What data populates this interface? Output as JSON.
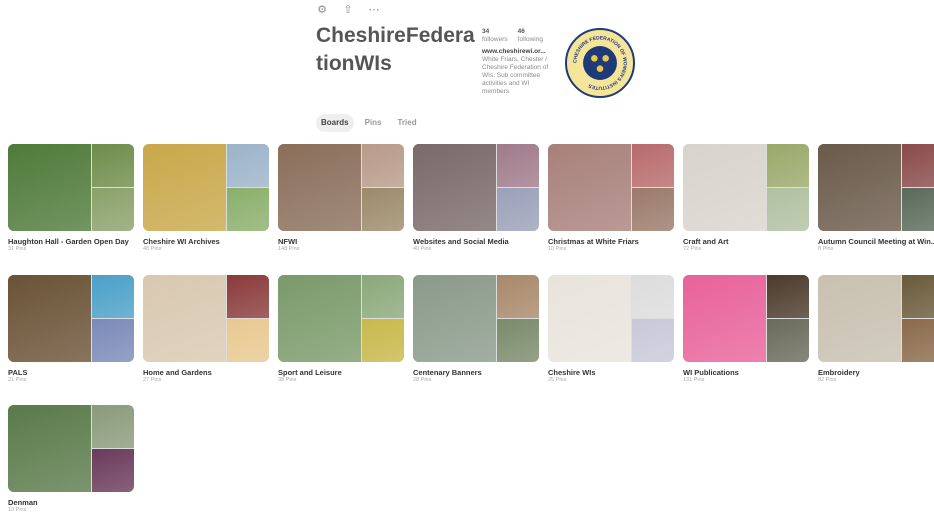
{
  "profile": {
    "name": "CheshireFederationWIs",
    "followers_count": "34",
    "followers_label": "followers",
    "following_count": "46",
    "following_label": "following",
    "website": "www.cheshirewi.or...",
    "bio": "White Friars, Chester / Cheshire Federation of WIs. Sub committee activities and WI members",
    "logo_text": "CHESHIRE FEDERATION OF WOMEN'S INSTITUTES"
  },
  "top_icons": [
    "gear-icon",
    "share-icon",
    "more-icon"
  ],
  "tabs": [
    {
      "label": "Boards",
      "active": true
    },
    {
      "label": "Pins",
      "active": false
    },
    {
      "label": "Tried",
      "active": false
    }
  ],
  "boards": [
    {
      "title": "Haughton Hall - Garden Open Day",
      "pins": "31 Pins",
      "colors": [
        "#4f7a3a",
        "#6e8c4a",
        "#8aa16a"
      ]
    },
    {
      "title": "Cheshire WI Archives",
      "pins": "48 Pins",
      "colors": [
        "#c9a84a",
        "#9bb3c8",
        "#8aaf6a"
      ]
    },
    {
      "title": "NFWI",
      "pins": "148 Pins",
      "colors": [
        "#8a6e5a",
        "#b89a88",
        "#9c8a6a"
      ]
    },
    {
      "title": "Websites and Social Media",
      "pins": "40 Pins",
      "colors": [
        "#7a6a6a",
        "#a07a8a",
        "#9aa0b8"
      ]
    },
    {
      "title": "Christmas at White Friars",
      "pins": "10 Pins",
      "colors": [
        "#a8807a",
        "#b86a6a",
        "#9a7a6a"
      ]
    },
    {
      "title": "Craft and Art",
      "pins": "72 Pins",
      "colors": [
        "#d8d4cc",
        "#9aa86a",
        "#b0c0a0"
      ]
    },
    {
      "title": "Autumn Council Meeting at Win...",
      "pins": "8 Pins",
      "colors": [
        "#6a5a4a",
        "#8a4a4a",
        "#5a6a5a"
      ]
    },
    {
      "title": "PALS",
      "pins": "21 Pins",
      "colors": [
        "#6a5236",
        "#4aa0c8",
        "#7a8ab8"
      ]
    },
    {
      "title": "Home and Gardens",
      "pins": "27 Pins",
      "colors": [
        "#d8c8b0",
        "#8a3a3a",
        "#e8c890"
      ]
    },
    {
      "title": "Sport and Leisure",
      "pins": "38 Pins",
      "colors": [
        "#7a9a6a",
        "#8aa87a",
        "#c8b84a"
      ]
    },
    {
      "title": "Centenary Banners",
      "pins": "28 Pins",
      "colors": [
        "#8a9a8a",
        "#a8886a",
        "#7a8a6a"
      ]
    },
    {
      "title": "Cheshire WIs",
      "pins": "25 Pins",
      "colors": [
        "#e8e4dc",
        "#dcdcdc",
        "#c8c8d8"
      ]
    },
    {
      "title": "WI Publications",
      "pins": "131 Pins",
      "colors": [
        "#e8629a",
        "#4a3a2a",
        "#6a6a5a"
      ]
    },
    {
      "title": "Embroidery",
      "pins": "82 Pins",
      "colors": [
        "#c8c0b0",
        "#6a5a3a",
        "#8a6a4a"
      ]
    },
    {
      "title": "Denman",
      "pins": "10 Pins",
      "colors": [
        "#5a7a4a",
        "#8a9a7a",
        "#6a3a5a"
      ]
    }
  ]
}
